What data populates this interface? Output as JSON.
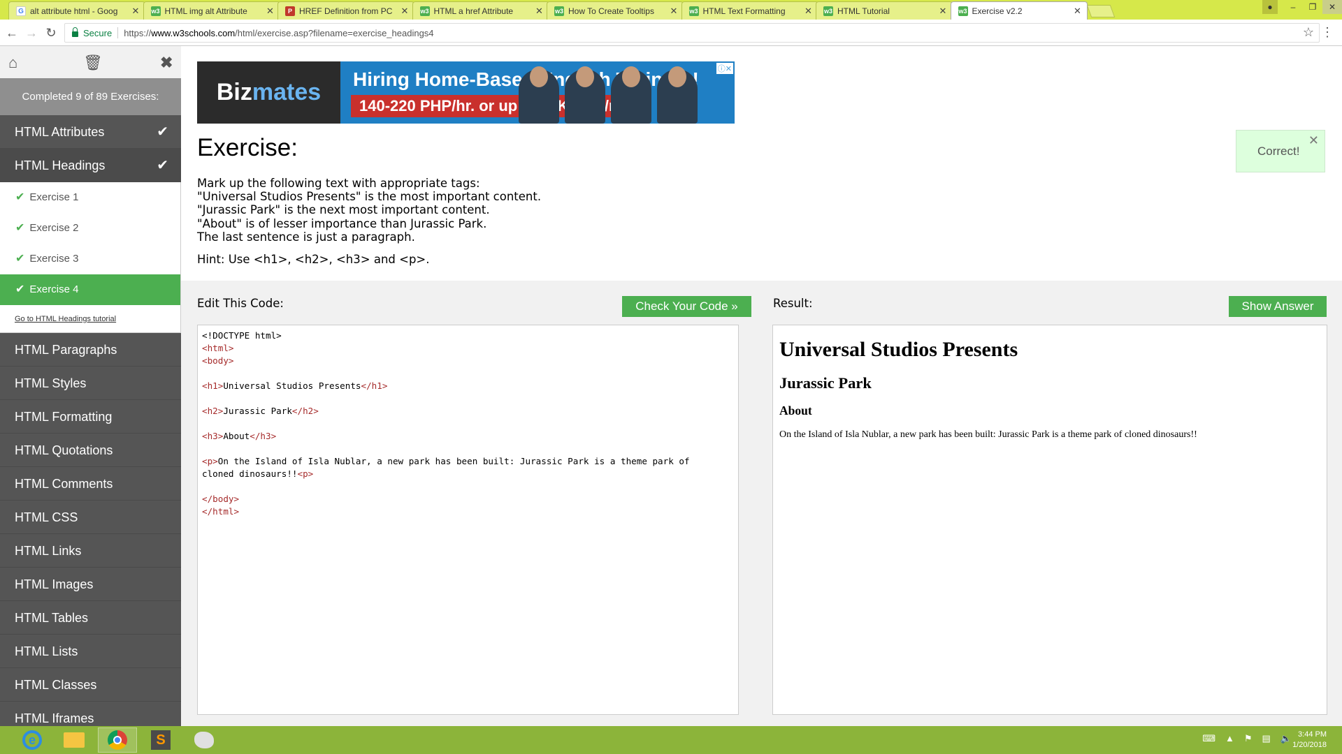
{
  "browser": {
    "tabs": [
      {
        "title": "alt attribute html - Goog",
        "favicon": "google-icon",
        "active": false
      },
      {
        "title": "HTML img alt Attribute",
        "favicon": "w3schools-icon",
        "active": false
      },
      {
        "title": "HREF Definition from PC",
        "favicon": "pcmag-icon",
        "active": false
      },
      {
        "title": "HTML a href Attribute",
        "favicon": "w3schools-icon",
        "active": false
      },
      {
        "title": "How To Create Tooltips",
        "favicon": "w3schools-icon",
        "active": false
      },
      {
        "title": "HTML Text Formatting",
        "favicon": "w3schools-icon",
        "active": false
      },
      {
        "title": "HTML Tutorial",
        "favicon": "w3schools-icon",
        "active": false
      },
      {
        "title": "Exercise v2.2",
        "favicon": "w3schools-icon",
        "active": true
      }
    ],
    "secure_label": "Secure",
    "url_prefix": "https://",
    "url_host": "www.w3schools.com",
    "url_path": "/html/exercise.asp?filename=exercise_headings4"
  },
  "sidebar": {
    "progress": "Completed 9 of 89 Exercises:",
    "chapters_before": [
      {
        "label": "HTML Attributes",
        "done": true
      },
      {
        "label": "HTML Headings",
        "done": true
      }
    ],
    "exercises": [
      {
        "label": "Exercise 1"
      },
      {
        "label": "Exercise 2"
      },
      {
        "label": "Exercise 3"
      },
      {
        "label": "Exercise 4"
      }
    ],
    "tutorial_link": "Go to HTML Headings tutorial",
    "chapters_after": [
      "HTML Paragraphs",
      "HTML Styles",
      "HTML Formatting",
      "HTML Quotations",
      "HTML Comments",
      "HTML CSS",
      "HTML Links",
      "HTML Images",
      "HTML Tables",
      "HTML Lists",
      "HTML Classes",
      "HTML Iframes"
    ]
  },
  "ad": {
    "brand_a": "Biz",
    "brand_b": "mates",
    "headline": "Hiring Home-Based English Trainers!",
    "subline": "140-220 PHP/hr. or up to 58K PHP/mo."
  },
  "exercise": {
    "title": "Exercise:",
    "instructions": [
      "Mark up the following text with appropriate tags:",
      "\"Universal Studios Presents\" is the most important content.",
      "\"Jurassic Park\" is the next most important content.",
      "\"About\" is of lesser importance than Jurassic Park.",
      "The last sentence is just a paragraph."
    ],
    "hint": "Hint: Use <h1>, <h2>, <h3> and <p>."
  },
  "toast": {
    "message": "Correct!"
  },
  "editor": {
    "title": "Edit This Code:",
    "check_button": "Check Your Code »",
    "doctype": "<!DOCTYPE html>",
    "html_open": "<html>",
    "body_open": "<body>",
    "h1_open": "<h1>",
    "h1_text": "Universal Studios Presents",
    "h1_close": "</h1>",
    "h2_open": "<h2>",
    "h2_text": "Jurassic Park",
    "h2_close": "</h2>",
    "h3_open": "<h3>",
    "h3_text": "About",
    "h3_close": "</h3>",
    "p_open": "<p>",
    "p_text_1": "On the Island of Isla Nublar, a new park has been built: Jurassic Park is a theme park of",
    "p_text_2": "cloned dinosaurs!!",
    "p_close": "<p>",
    "body_close": "</body>",
    "html_close": "</html>"
  },
  "result": {
    "title": "Result:",
    "show_answer_button": "Show Answer",
    "h1": "Universal Studios Presents",
    "h2": "Jurassic Park",
    "h3": "About",
    "p": "On the Island of Isla Nublar, a new park has been built: Jurassic Park is a theme park of cloned dinosaurs!!"
  },
  "taskbar": {
    "time": "3:44 PM",
    "date": "1/20/2018"
  }
}
